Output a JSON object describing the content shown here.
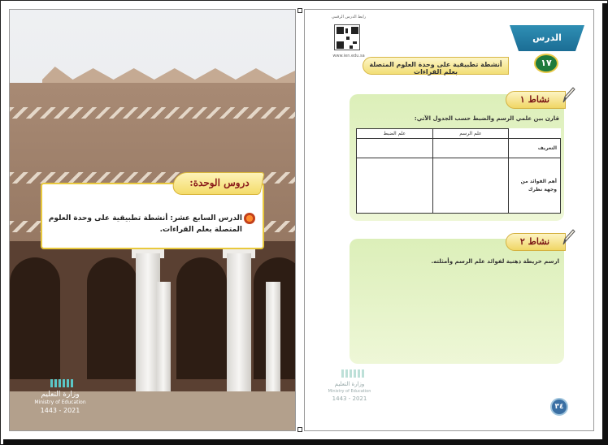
{
  "left_page": {
    "units_title": "دروس الوحدة:",
    "unit_lesson": "الدرس السابع عشر: أنشطة تطبيقية على وحدة العلوم المتصلة بعلم القراءات.",
    "ministry_ar": "وزارة التعليم",
    "ministry_en": "Ministry of Education",
    "year": "2021 - 1443"
  },
  "right_page": {
    "lesson_label": "الدرس",
    "lesson_number": "١٧",
    "lesson_title": "أنشطة تطبيقية على وحدة العلوم المتصلة بعلم القراءات",
    "qr_caption": "رابط الدرس الرقمي",
    "qr_url": "www.ien.edu.sa",
    "activity1": {
      "label": "نشاط ١",
      "instruction": "قارن بين علمي الرسم والضبط حسب الجدول الآتي:",
      "col_rasm": "علم الرسم",
      "col_dabt": "علم الضبط",
      "row_definition": "التعريف",
      "row_benefits": "أهم الفوائد من وجهة نظرك"
    },
    "activity2": {
      "label": "نشاط ٢",
      "instruction": "ارسم خريطة ذهنية لفوائد علم الرسم وأمثلته."
    },
    "page_number": "٣٤",
    "ministry_ar": "وزارة التعليم",
    "ministry_en": "Ministry of Education",
    "year": "2021 - 1443"
  },
  "colors": {
    "lesson_blue": "#1b6d95",
    "activity_green": "#dcefb9",
    "heading_gold": "#f0d665",
    "heading_red": "#7a1515"
  }
}
